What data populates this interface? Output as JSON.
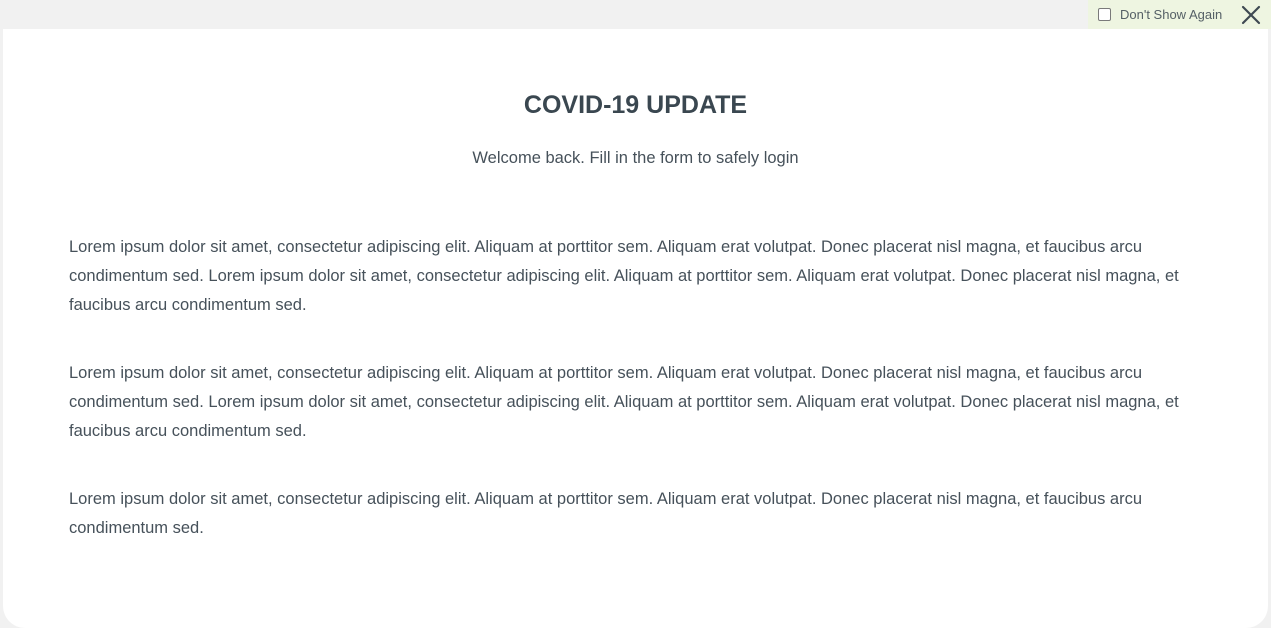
{
  "header": {
    "dont_show_label": "Don't Show Again",
    "dont_show_checked": false
  },
  "modal": {
    "title": "COVID-19 UPDATE",
    "subtitle": "Welcome back. Fill in the form to safely login",
    "paragraphs": [
      "Lorem ipsum dolor sit amet, consectetur adipiscing elit. Aliquam at porttitor sem.  Aliquam erat volutpat. Donec placerat nisl magna, et faucibus arcu condimentum sed. Lorem ipsum dolor sit amet, consectetur adipiscing elit. Aliquam at porttitor sem.  Aliquam erat volutpat. Donec placerat nisl magna, et faucibus arcu condimentum sed.",
      "Lorem ipsum dolor sit amet, consectetur adipiscing elit. Aliquam at porttitor sem.  Aliquam erat volutpat. Donec placerat nisl magna, et faucibus arcu condimentum sed. Lorem ipsum dolor sit amet, consectetur adipiscing elit. Aliquam at porttitor sem.  Aliquam erat volutpat. Donec placerat nisl magna, et faucibus arcu condimentum sed.",
      "Lorem ipsum dolor sit amet, consectetur adipiscing elit. Aliquam at porttitor sem.  Aliquam erat volutpat. Donec placerat nisl magna, et faucibus arcu condimentum sed."
    ]
  },
  "icons": {
    "close": "close-icon",
    "checkbox": "checkbox"
  },
  "colors": {
    "text": "#46515a",
    "title": "#3a4750",
    "dont_show_bg": "#eef5e1",
    "page_bg": "#f1f1f1",
    "modal_bg": "#ffffff"
  }
}
